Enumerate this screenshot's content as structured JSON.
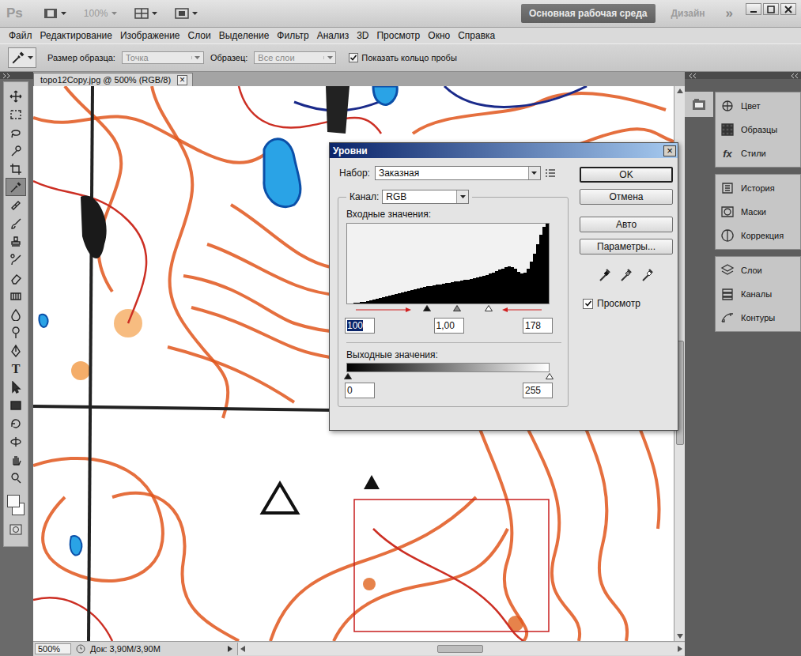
{
  "app_bar": {
    "logo": "Ps",
    "zoom": {
      "label": "100%",
      "disabled": true
    },
    "workspaces": [
      {
        "label": "Основная рабочая среда",
        "selected": true
      },
      {
        "label": "Дизайн",
        "selected": false
      }
    ],
    "more": "»"
  },
  "menu": [
    "Файл",
    "Редактирование",
    "Изображение",
    "Слои",
    "Выделение",
    "Фильтр",
    "Анализ",
    "3D",
    "Просмотр",
    "Окно",
    "Справка"
  ],
  "options_bar": {
    "sample_size": {
      "label": "Размер образца:",
      "value": "Точка",
      "disabled": true
    },
    "sample": {
      "label": "Образец:",
      "value": "Все слои",
      "disabled": true
    },
    "show_ring": {
      "label": "Показать кольцо пробы",
      "checked": true
    }
  },
  "tools": [
    {
      "kind": "move",
      "selected": false
    },
    {
      "kind": "marquee",
      "selected": false
    },
    {
      "kind": "lasso",
      "selected": false
    },
    {
      "kind": "quick-select",
      "selected": false
    },
    {
      "kind": "crop",
      "selected": false
    },
    {
      "kind": "eyedropper",
      "selected": true
    },
    {
      "kind": "healing",
      "selected": false
    },
    {
      "kind": "brush",
      "selected": false
    },
    {
      "kind": "stamp",
      "selected": false
    },
    {
      "kind": "history-brush",
      "selected": false
    },
    {
      "kind": "eraser",
      "selected": false
    },
    {
      "kind": "gradient",
      "selected": false
    },
    {
      "kind": "blur",
      "selected": false
    },
    {
      "kind": "dodge",
      "selected": false
    },
    {
      "kind": "pen",
      "selected": false
    },
    {
      "kind": "type",
      "selected": false,
      "glyph": "T"
    },
    {
      "kind": "path-select",
      "selected": false
    },
    {
      "kind": "shape",
      "selected": false
    },
    {
      "kind": "3d-rotate",
      "selected": false
    },
    {
      "kind": "3d-orbit",
      "selected": false
    },
    {
      "kind": "hand",
      "selected": false
    },
    {
      "kind": "zoom",
      "selected": false
    }
  ],
  "document": {
    "tab": "topo12Copy.jpg @ 500% (RGB/8)",
    "close": "×"
  },
  "panels": [
    {
      "items": [
        {
          "label": "Цвет",
          "kind": "color"
        },
        {
          "label": "Образцы",
          "kind": "swatches"
        },
        {
          "label": "Стили",
          "kind": "styles",
          "glyph": "fx"
        }
      ]
    },
    {
      "items": [
        {
          "label": "История",
          "kind": "history"
        },
        {
          "label": "Маски",
          "kind": "masks"
        },
        {
          "label": "Коррекция",
          "kind": "adjustments"
        }
      ]
    },
    {
      "items": [
        {
          "label": "Слои",
          "kind": "layers"
        },
        {
          "label": "Каналы",
          "kind": "channels"
        },
        {
          "label": "Контуры",
          "kind": "paths"
        }
      ]
    }
  ],
  "status_bar": {
    "zoom": "500%",
    "doc": "Док: 3,90M/3,90M"
  },
  "levels_dialog": {
    "title": "Уровни",
    "close": "×",
    "preset": {
      "label": "Набор:",
      "value": "Заказная"
    },
    "channel": {
      "label": "Канал:",
      "value": "RGB"
    },
    "input": {
      "label": "Входные значения:",
      "histogram": [
        0,
        0,
        1,
        1,
        2,
        2,
        3,
        4,
        5,
        6,
        7,
        8,
        9,
        10,
        11,
        12,
        13,
        14,
        15,
        16,
        17,
        18,
        19,
        20,
        21,
        22,
        22,
        23,
        24,
        24,
        25,
        26,
        26,
        27,
        28,
        28,
        29,
        30,
        30,
        31,
        32,
        33,
        34,
        35,
        36,
        38,
        39,
        41,
        43,
        44,
        46,
        47,
        46,
        44,
        40,
        38,
        39,
        44,
        52,
        62,
        74,
        86,
        96,
        100
      ],
      "black": {
        "value": "100",
        "level": 0.392,
        "selected": true
      },
      "gamma": {
        "value": "1,00",
        "level": 0.541,
        "selected": false
      },
      "white": {
        "value": "178",
        "level": 0.698,
        "selected": false
      }
    },
    "output": {
      "label": "Выходные значения:",
      "black": {
        "value": "0",
        "level": 0,
        "selected": false
      },
      "white": {
        "value": "255",
        "level": 1,
        "selected": false
      }
    },
    "buttons": [
      {
        "label": "OK",
        "default": true
      },
      {
        "label": "Отмена",
        "default": false
      },
      {
        "label": "Авто",
        "default": false
      },
      {
        "label": "Параметры...",
        "default": false
      }
    ],
    "preview": {
      "label": "Просмотр",
      "checked": true
    }
  }
}
